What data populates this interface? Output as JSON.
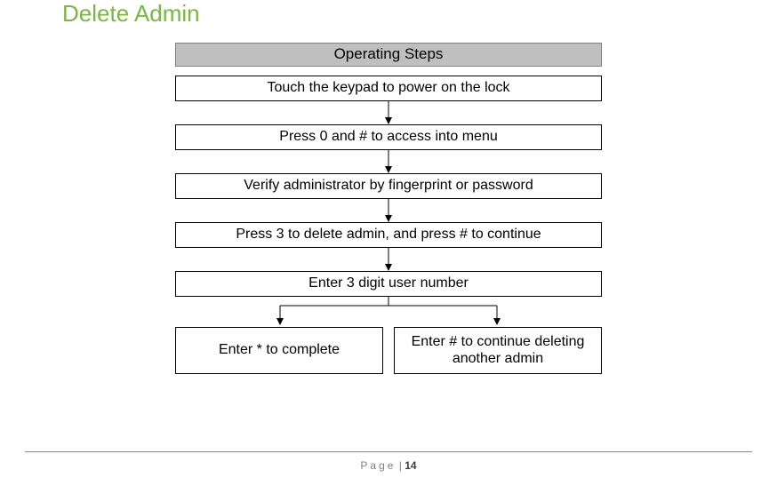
{
  "title": "Delete Admin",
  "header": "Operating Steps",
  "steps": {
    "s1": "Touch the keypad to power on the lock",
    "s2": "Press  0 and  # to access into menu",
    "s3": "Verify administrator by fingerprint or password",
    "s4": "Press 3 to delete admin, and press # to continue",
    "s5": "Enter 3 digit user number",
    "left": "Enter * to complete",
    "right": "Enter # to continue deleting another admin"
  },
  "footer": {
    "label": "Page",
    "sep": " | ",
    "num": "14"
  }
}
